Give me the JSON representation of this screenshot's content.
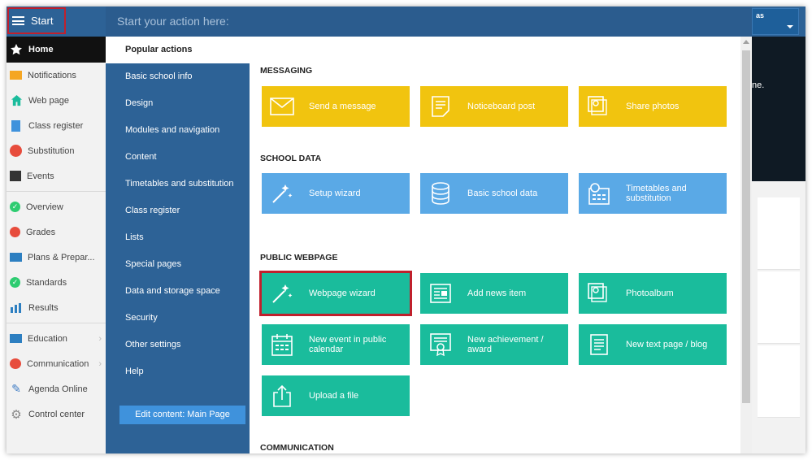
{
  "topbar": {
    "start_label": "Start",
    "search_placeholder": "Start your action here:",
    "user_text": "as"
  },
  "sidebar": {
    "items": [
      {
        "label": "Home",
        "icon": "star-icon"
      },
      {
        "label": "Notifications",
        "icon": "envelope-icon"
      },
      {
        "label": "Web page",
        "icon": "house-icon"
      },
      {
        "label": "Class register",
        "icon": "book-icon"
      },
      {
        "label": "Substitution",
        "icon": "person-icon"
      },
      {
        "label": "Events",
        "icon": "calendar-icon"
      },
      {
        "label": "Overview",
        "icon": "check-circle-icon"
      },
      {
        "label": "Grades",
        "icon": "grade-icon"
      },
      {
        "label": "Plans & Prepar...",
        "icon": "briefcase-icon"
      },
      {
        "label": "Standards",
        "icon": "shield-check-icon"
      },
      {
        "label": "Results",
        "icon": "bar-chart-icon"
      },
      {
        "label": "Education",
        "icon": "open-book-icon"
      },
      {
        "label": "Communication",
        "icon": "chat-icon"
      },
      {
        "label": "Agenda Online",
        "icon": "pen-icon"
      },
      {
        "label": "Control center",
        "icon": "gear-icon"
      }
    ]
  },
  "menu": {
    "items": [
      "Popular actions",
      "Basic school info",
      "Design",
      "Modules and navigation",
      "Content",
      "Timetables and substitution",
      "Class register",
      "Lists",
      "Special pages",
      "Data and storage space",
      "Security",
      "Other settings",
      "Help"
    ],
    "edit_button": "Edit content: Main Page"
  },
  "panel": {
    "sections": {
      "messaging": "MESSAGING",
      "school_data": "SCHOOL DATA",
      "public_webpage": "PUBLIC WEBPAGE",
      "communication": "COMMUNICATION"
    },
    "tiles": {
      "send_message": "Send a message",
      "noticeboard_post": "Noticeboard post",
      "share_photos": "Share photos",
      "setup_wizard": "Setup wizard",
      "basic_school_data": "Basic school data",
      "timetables": "Timetables and substitution",
      "webpage_wizard": "Webpage wizard",
      "add_news": "Add news item",
      "photoalbum": "Photoalbum",
      "new_event": "New event in public calendar",
      "new_achievement": "New achievement / award",
      "new_text_page": "New text page / blog",
      "upload_file": "Upload a file"
    }
  },
  "background": {
    "fragment_text": "ne."
  },
  "colors": {
    "topbar": "#2d6296",
    "yellow_tile": "#f1c40f",
    "blue_tile": "#5aa9e6",
    "green_tile": "#1abc9c",
    "highlight": "#c0202c"
  }
}
